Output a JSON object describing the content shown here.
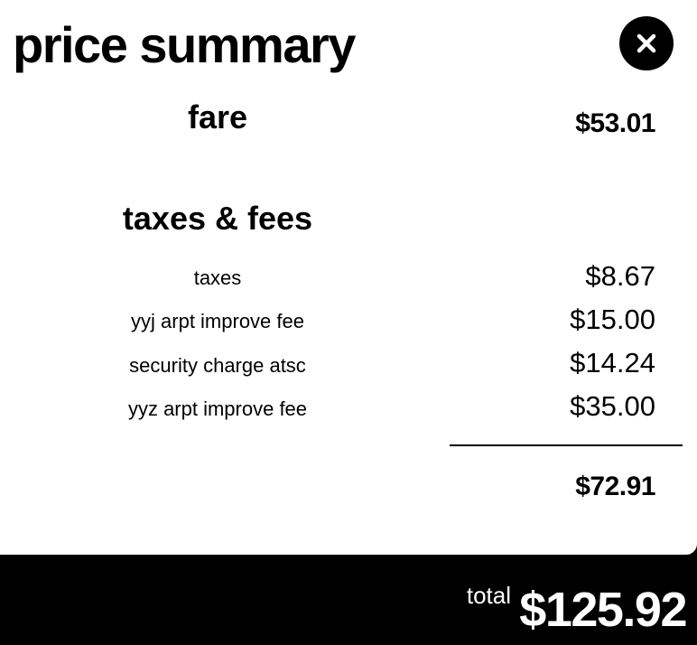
{
  "header": {
    "title": "price summary",
    "close_icon": "close-icon"
  },
  "fare": {
    "label": "fare",
    "amount": "$53.01"
  },
  "taxes_fees": {
    "heading": "taxes & fees",
    "items": [
      {
        "label": "taxes",
        "amount": "$8.67"
      },
      {
        "label": "yyj arpt improve fee",
        "amount": "$15.00"
      },
      {
        "label": "security charge atsc",
        "amount": "$14.24"
      },
      {
        "label": "yyz arpt improve fee",
        "amount": "$35.00"
      }
    ],
    "subtotal": "$72.91"
  },
  "footer": {
    "total_label": "total",
    "total_amount": "$125.92"
  },
  "colors": {
    "panel_bg": "#ffffff",
    "footer_bg": "#000000",
    "text": "#000000",
    "footer_text": "#ffffff"
  }
}
